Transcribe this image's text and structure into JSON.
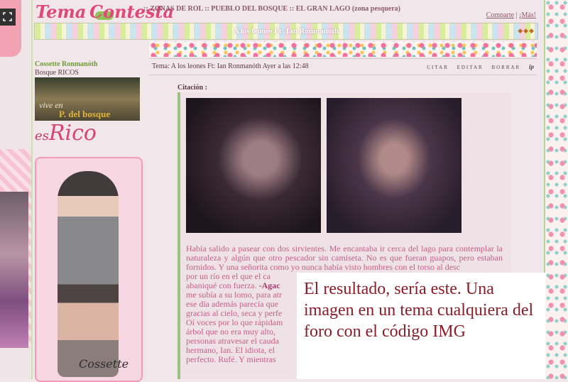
{
  "header": {
    "logo_word1": "Tema",
    "logo_word2": "Contesta",
    "breadcrumb": [
      ":: ZONAS DE ROL",
      ":: PUEBLO DEL BOSQUE",
      ":: EL GRAN LAGO (zona pesquera)"
    ],
    "share_link": "Comparte",
    "more_link": "¡Más!"
  },
  "topic_bar": {
    "title": "A los leones Ft: Ian Ronmanoth",
    "arrows": "◆◆◆"
  },
  "post": {
    "header_text": "Tema: A los leones Ft: Ian Ronmanóth   Ayer a las 12:48",
    "actions": [
      "CITAR",
      "EDITAR",
      "BORRAR",
      "ip"
    ],
    "citation_label": "Citación :",
    "story": [
      "Había salido a pasear con dos sirvientes. Me encantaba ir cerca del lago para contemplar la naturaleza y algún que otro pescador sin camiseta. No es que fueran guapos, pero estaban fornidos. Y una señorita como yo nunca había visto hombres con el torso al desc",
      "por un río en el que el ca",
      "abaniqué con fuerza.",
      "-Agac",
      "me subía a su lomo, para atr",
      "ese día además parecía que",
      "gracias al cielo, seca y perfe",
      "Oí voces por lo que rápidam",
      "árbol que no era muy alto,",
      "personas atravesar el cauda",
      "hermano, Ian. El idiota, el",
      "perfecto. Rufé. Y mientras"
    ]
  },
  "user": {
    "name": "Cossette Ronmanóth",
    "rank": "Bosque RICOS",
    "banner_line1": "vive en",
    "banner_line2": "P. del bosque",
    "rico_prefix": "es",
    "rico_word": "Rico",
    "signature": "Cossette"
  },
  "caption": {
    "text": "El resultado, sería este. Una imagen en un tema cualquiera del foro con el código IMG"
  }
}
